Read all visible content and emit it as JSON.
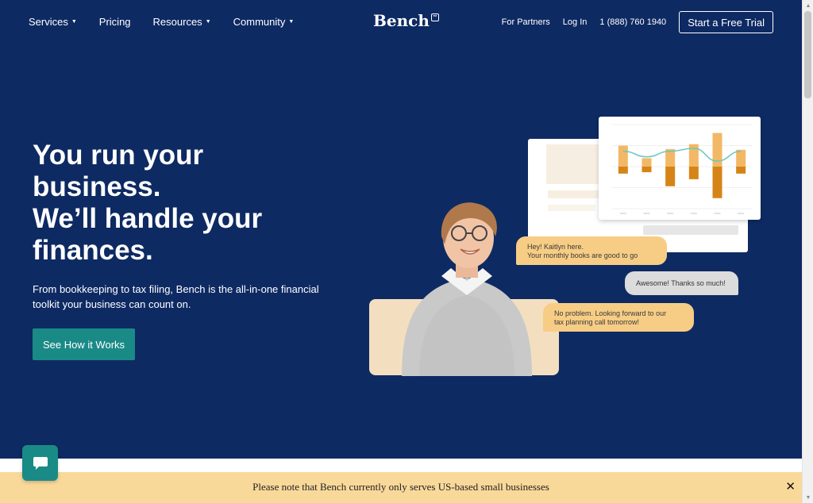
{
  "nav": {
    "items": [
      {
        "label": "Services",
        "has_caret": true
      },
      {
        "label": "Pricing",
        "has_caret": false
      },
      {
        "label": "Resources",
        "has_caret": true
      },
      {
        "label": "Community",
        "has_caret": true
      }
    ],
    "logo": "Bench",
    "logo_badge": "™",
    "partners": "For Partners",
    "login": "Log In",
    "phone": "1 (888) 760 1940",
    "trial_button": "Start a Free Trial"
  },
  "hero": {
    "headline": [
      "You run your",
      "business.",
      "We’ll handle your",
      "finances."
    ],
    "subtext": "From bookkeeping to tax filing, Bench is the all-in-one financial toolkit your business can count on.",
    "cta": "See How it Works"
  },
  "illustration": {
    "bubble_1": [
      "Hey! Kaitlyn here.",
      "Your monthly books are good to go"
    ],
    "bubble_2": "Awesome! Thanks so much!",
    "bubble_3": [
      "No problem. Looking forward to our",
      "tax planning call tomorrow!"
    ]
  },
  "chart_data": {
    "type": "bar",
    "categories": [
      "1",
      "2",
      "3",
      "4",
      "5",
      "6"
    ],
    "series": [
      {
        "values": [
          30,
          12,
          25,
          32,
          48,
          24
        ]
      },
      {
        "values": [
          -10,
          -8,
          -28,
          -18,
          -45,
          -10
        ]
      }
    ],
    "line": [
      22,
      14,
      22,
      26,
      8,
      22
    ],
    "ylim": [
      -60,
      60
    ],
    "colors": {
      "positive": "#f2b866",
      "negative": "#d68417",
      "line": "#66c7bf"
    }
  },
  "notice": {
    "text": "Please note that Bench currently only serves US-based small businesses",
    "close": "✕"
  },
  "colors": {
    "hero_bg": "#0e2a63",
    "accent": "#1a8a87",
    "notice_bg": "#f9d99a",
    "bubble": "#f7cd85"
  }
}
